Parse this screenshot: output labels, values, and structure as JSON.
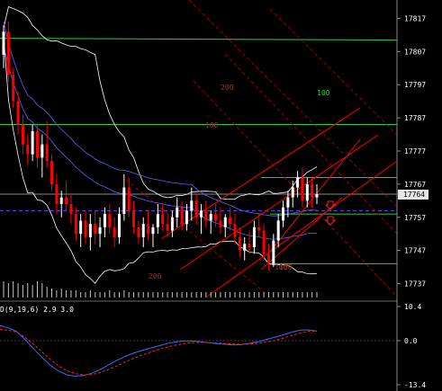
{
  "chart_data": [
    {
      "type": "candlestick",
      "panel": "price",
      "y_axis": {
        "min": 17732,
        "max": 17822,
        "ticks": [
          17817,
          17807,
          17797,
          17787,
          17777,
          17767,
          17757,
          17747,
          17737
        ]
      },
      "current_price": 17764,
      "current_price_label": "17764",
      "colors": {
        "up": "#ffffff",
        "down": "#ff0000",
        "price_line": "#8a8a8a",
        "band": "#ffffff",
        "ma": "#6060ff",
        "level": "#2ecc40",
        "channel": "#ff0000",
        "channel_dash": "#a00000"
      },
      "candles": [
        [
          17806,
          17815,
          17802,
          17813
        ],
        [
          17813,
          17816,
          17798,
          17800
        ],
        [
          17800,
          17802,
          17790,
          17792
        ],
        [
          17792,
          17795,
          17782,
          17785
        ],
        [
          17785,
          17788,
          17776,
          17779
        ],
        [
          17779,
          17782,
          17773,
          17776
        ],
        [
          17776,
          17785,
          17774,
          17783
        ],
        [
          17783,
          17785,
          17772,
          17775
        ],
        [
          17775,
          17782,
          17769,
          17779
        ],
        [
          17779,
          17786,
          17772,
          17774
        ],
        [
          17774,
          17776,
          17765,
          17767
        ],
        [
          17767,
          17770,
          17758,
          17761
        ],
        [
          17761,
          17765,
          17757,
          17763
        ],
        [
          17763,
          17768,
          17759,
          17761
        ],
        [
          17761,
          17764,
          17755,
          17758
        ],
        [
          17758,
          17760,
          17750,
          17752
        ],
        [
          17752,
          17758,
          17748,
          17756
        ],
        [
          17756,
          17759,
          17749,
          17751
        ],
        [
          17751,
          17758,
          17747,
          17755
        ],
        [
          17755,
          17759,
          17749,
          17752
        ],
        [
          17752,
          17757,
          17748,
          17754
        ],
        [
          17754,
          17760,
          17751,
          17758
        ],
        [
          17758,
          17761,
          17752,
          17754
        ],
        [
          17754,
          17757,
          17748,
          17751
        ],
        [
          17751,
          17760,
          17749,
          17758
        ],
        [
          17758,
          17770,
          17756,
          17766
        ],
        [
          17766,
          17769,
          17757,
          17759
        ],
        [
          17759,
          17762,
          17752,
          17754
        ],
        [
          17754,
          17756,
          17749,
          17751
        ],
        [
          17751,
          17757,
          17748,
          17755
        ],
        [
          17755,
          17759,
          17750,
          17752
        ],
        [
          17752,
          17755,
          17748,
          17754
        ],
        [
          17754,
          17761,
          17752,
          17758
        ],
        [
          17758,
          17761,
          17753,
          17755
        ],
        [
          17755,
          17758,
          17751,
          17753
        ],
        [
          17753,
          17759,
          17751,
          17757
        ],
        [
          17757,
          17763,
          17754,
          17760
        ],
        [
          17760,
          17762,
          17753,
          17755
        ],
        [
          17755,
          17761,
          17753,
          17759
        ],
        [
          17759,
          17766,
          17756,
          17762
        ],
        [
          17762,
          17764,
          17755,
          17757
        ],
        [
          17757,
          17761,
          17752,
          17759
        ],
        [
          17759,
          17762,
          17754,
          17756
        ],
        [
          17756,
          17759,
          17752,
          17758
        ],
        [
          17758,
          17761,
          17754,
          17756
        ],
        [
          17756,
          17760,
          17752,
          17754
        ],
        [
          17754,
          17758,
          17751,
          17757
        ],
        [
          17757,
          17760,
          17753,
          17755
        ],
        [
          17755,
          17758,
          17749,
          17751
        ],
        [
          17751,
          17754,
          17745,
          17747
        ],
        [
          17747,
          17751,
          17744,
          17749
        ],
        [
          17749,
          17753,
          17746,
          17748
        ],
        [
          17748,
          17756,
          17746,
          17754
        ],
        [
          17754,
          17758,
          17751,
          17753
        ],
        [
          17753,
          17755,
          17744,
          17746
        ],
        [
          17746,
          17749,
          17741,
          17743
        ],
        [
          17743,
          17752,
          17742,
          17750
        ],
        [
          17750,
          17758,
          17748,
          17756
        ],
        [
          17756,
          17762,
          17754,
          17760
        ],
        [
          17760,
          17765,
          17757,
          17763
        ],
        [
          17763,
          17768,
          17760,
          17766
        ],
        [
          17766,
          17771,
          17763,
          17769
        ],
        [
          17769,
          17772,
          17760,
          17762
        ],
        [
          17762,
          17769,
          17760,
          17767
        ],
        [
          17767,
          17769,
          17760,
          17763
        ],
        [
          17763,
          17767,
          17761,
          17764
        ]
      ],
      "volume": [
        9,
        8,
        9,
        8,
        7,
        8,
        7,
        9,
        8,
        6,
        5,
        4,
        5,
        4,
        4,
        4,
        3,
        3,
        4,
        3,
        3,
        3,
        4,
        3,
        3,
        4,
        3,
        3,
        3,
        3,
        3,
        3,
        3,
        3,
        3,
        3,
        3,
        3,
        3,
        3,
        3,
        3,
        3,
        3,
        3,
        3,
        3,
        3,
        3,
        3,
        3,
        3,
        3,
        3,
        3,
        3,
        3,
        3,
        3,
        3,
        3,
        3,
        3,
        3,
        3,
        3
      ],
      "horizontal_levels": [
        17811,
        17785,
        17769,
        17758,
        17743
      ],
      "fib_labels": [
        "200",
        "100",
        "100",
        "200",
        "100",
        "100"
      ]
    },
    {
      "type": "line",
      "panel": "indicator",
      "title": "D(9,19,6) 2.9 3.0",
      "ylim": [
        -13.4,
        10.4
      ],
      "ticks": [
        "10.4",
        "0.0",
        "-13.4"
      ],
      "series": [
        {
          "color": "#3a6bff",
          "values": [
            4.6,
            3.9,
            2.8,
            0.4,
            -2.4,
            -5.0,
            -7.4,
            -9.2,
            -10.4,
            -10.8,
            -10.6,
            -9.9,
            -8.8,
            -7.4,
            -6.0,
            -4.8,
            -3.8,
            -3.0,
            -2.3,
            -1.6,
            -0.9,
            -0.4,
            -0.1,
            -0.1,
            -0.3,
            -0.6,
            -0.9,
            -1.1,
            -1.3,
            -1.2,
            -0.8,
            -0.3,
            0.4,
            1.1,
            1.8,
            2.6,
            3.2,
            3.3,
            2.9
          ]
        },
        {
          "color": "#ff2020",
          "values": [
            3.4,
            3.2,
            2.6,
            1.0,
            -1.1,
            -3.4,
            -5.6,
            -7.6,
            -9.1,
            -10.0,
            -10.4,
            -10.3,
            -9.7,
            -8.8,
            -7.7,
            -6.5,
            -5.4,
            -4.4,
            -3.5,
            -2.7,
            -2.0,
            -1.4,
            -0.9,
            -0.6,
            -0.5,
            -0.6,
            -0.7,
            -0.9,
            -1.0,
            -1.1,
            -1.0,
            -0.8,
            -0.4,
            0.1,
            0.8,
            1.6,
            2.3,
            2.8,
            3.0
          ]
        }
      ]
    }
  ]
}
